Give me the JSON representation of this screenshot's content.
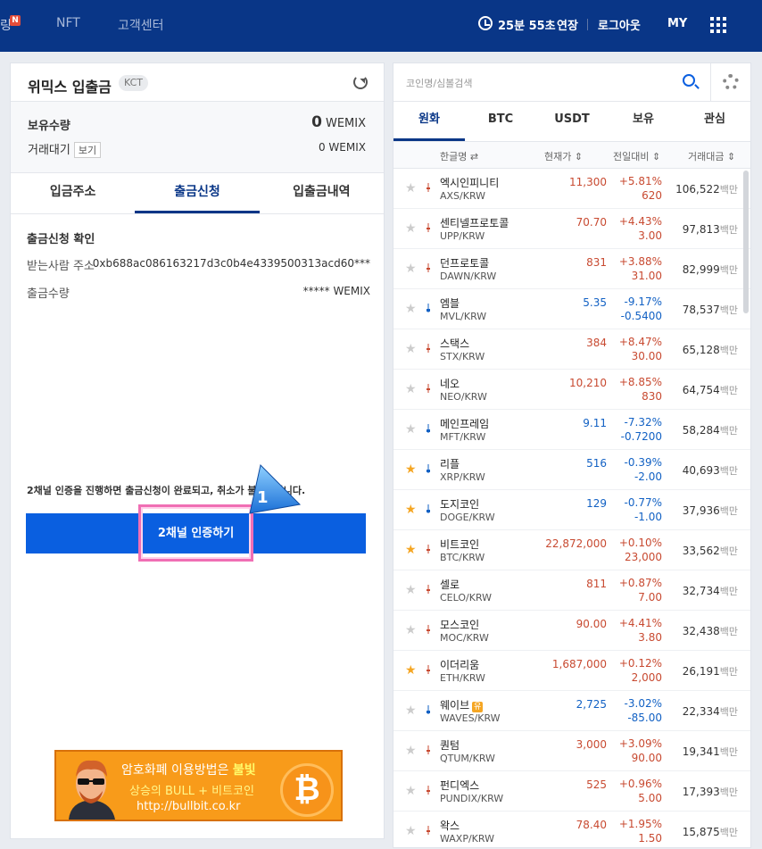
{
  "topnav": {
    "frag_label": "링",
    "new_badge": "N",
    "links": [
      "NFT",
      "고객센터"
    ],
    "timer": "25분 55초",
    "extend": "연장",
    "logout": "로그아웃",
    "my": "MY"
  },
  "wallet": {
    "title": "위믹스 입출금",
    "tag": "KCT",
    "holdings_label": "보유수량",
    "holdings_value": "0",
    "holdings_unit": "WEMIX",
    "pending_label": "거래대기",
    "view_button": "보기",
    "pending_value": "0 WEMIX",
    "tabs": [
      "입금주소",
      "출금신청",
      "입출금내역"
    ],
    "active_tab": 1,
    "confirm_title": "출금신청 확인",
    "recipient_label": "받는사람 주소",
    "recipient_value": "0xb688ac086163217d3c0b4e4339500313acd60***",
    "amount_label": "출금수량",
    "amount_value": "***** WEMIX",
    "notice": "2채널 인증을 진행하면 출금신청이 완료되고, 취소가 불가능합니다.",
    "cta_button": "2채널 인증하기",
    "callout_number": "1"
  },
  "banner": {
    "line1_prefix": "암호화폐 이용방법은 ",
    "line1_highlight": "불빛",
    "line2": "상승의 BULL + 비트코인",
    "line3": "http://bullbit.co.kr",
    "coin_symbol": "₿"
  },
  "market": {
    "search_placeholder": "코인명/심볼검색",
    "tabs": [
      "원화",
      "BTC",
      "USDT",
      "보유",
      "관심"
    ],
    "active_tab": 0,
    "columns": {
      "name": "한글명 ⇄",
      "price": "현재가 ⇕",
      "change": "전일대비 ⇕",
      "volume": "거래대금 ⇕"
    },
    "rows": [
      {
        "name": "엑시인피니티",
        "symbol": "AXS/KRW",
        "price": "11,300",
        "pct": "+5.81%",
        "chg": "620",
        "vol": "106,522",
        "unit": "백만",
        "dir": "up",
        "star": false
      },
      {
        "name": "센티넬프로토콜",
        "symbol": "UPP/KRW",
        "price": "70.70",
        "pct": "+4.43%",
        "chg": "3.00",
        "vol": "97,813",
        "unit": "백만",
        "dir": "up",
        "star": false
      },
      {
        "name": "던프로토콜",
        "symbol": "DAWN/KRW",
        "price": "831",
        "pct": "+3.88%",
        "chg": "31.00",
        "vol": "82,999",
        "unit": "백만",
        "dir": "up",
        "star": false
      },
      {
        "name": "엠블",
        "symbol": "MVL/KRW",
        "price": "5.35",
        "pct": "-9.17%",
        "chg": "-0.5400",
        "vol": "78,537",
        "unit": "백만",
        "dir": "dn",
        "star": false
      },
      {
        "name": "스택스",
        "symbol": "STX/KRW",
        "price": "384",
        "pct": "+8.47%",
        "chg": "30.00",
        "vol": "65,128",
        "unit": "백만",
        "dir": "up",
        "star": false
      },
      {
        "name": "네오",
        "symbol": "NEO/KRW",
        "price": "10,210",
        "pct": "+8.85%",
        "chg": "830",
        "vol": "64,754",
        "unit": "백만",
        "dir": "up",
        "star": false
      },
      {
        "name": "메인프레임",
        "symbol": "MFT/KRW",
        "price": "9.11",
        "pct": "-7.32%",
        "chg": "-0.7200",
        "vol": "58,284",
        "unit": "백만",
        "dir": "dn",
        "star": false
      },
      {
        "name": "리플",
        "symbol": "XRP/KRW",
        "price": "516",
        "pct": "-0.39%",
        "chg": "-2.00",
        "vol": "40,693",
        "unit": "백만",
        "dir": "dn",
        "star": true
      },
      {
        "name": "도지코인",
        "symbol": "DOGE/KRW",
        "price": "129",
        "pct": "-0.77%",
        "chg": "-1.00",
        "vol": "37,936",
        "unit": "백만",
        "dir": "dn",
        "star": true
      },
      {
        "name": "비트코인",
        "symbol": "BTC/KRW",
        "price": "22,872,000",
        "pct": "+0.10%",
        "chg": "23,000",
        "vol": "33,562",
        "unit": "백만",
        "dir": "up",
        "star": true
      },
      {
        "name": "셀로",
        "symbol": "CELO/KRW",
        "price": "811",
        "pct": "+0.87%",
        "chg": "7.00",
        "vol": "32,734",
        "unit": "백만",
        "dir": "up",
        "star": false
      },
      {
        "name": "모스코인",
        "symbol": "MOC/KRW",
        "price": "90.00",
        "pct": "+4.41%",
        "chg": "3.80",
        "vol": "32,438",
        "unit": "백만",
        "dir": "up",
        "star": false
      },
      {
        "name": "이더리움",
        "symbol": "ETH/KRW",
        "price": "1,687,000",
        "pct": "+0.12%",
        "chg": "2,000",
        "vol": "26,191",
        "unit": "백만",
        "dir": "up",
        "star": true
      },
      {
        "name": "웨이브",
        "symbol": "WAVES/KRW",
        "price": "2,725",
        "pct": "-3.02%",
        "chg": "-85.00",
        "vol": "22,334",
        "unit": "백만",
        "dir": "dn",
        "star": false,
        "badge": "유"
      },
      {
        "name": "퀀텀",
        "symbol": "QTUM/KRW",
        "price": "3,000",
        "pct": "+3.09%",
        "chg": "90.00",
        "vol": "19,341",
        "unit": "백만",
        "dir": "up",
        "star": false
      },
      {
        "name": "펀디엑스",
        "symbol": "PUNDIX/KRW",
        "price": "525",
        "pct": "+0.96%",
        "chg": "5.00",
        "vol": "17,393",
        "unit": "백만",
        "dir": "up",
        "star": false
      },
      {
        "name": "왁스",
        "symbol": "WAXP/KRW",
        "price": "78.40",
        "pct": "+1.95%",
        "chg": "1.50",
        "vol": "15,875",
        "unit": "백만",
        "dir": "up",
        "star": false
      }
    ]
  },
  "colors": {
    "nav_bg": "#093687",
    "accent": "#0a5fe0",
    "up": "#c84a31",
    "down": "#1261c4",
    "star": "#f5a623",
    "highlight": "#f06eb4"
  }
}
